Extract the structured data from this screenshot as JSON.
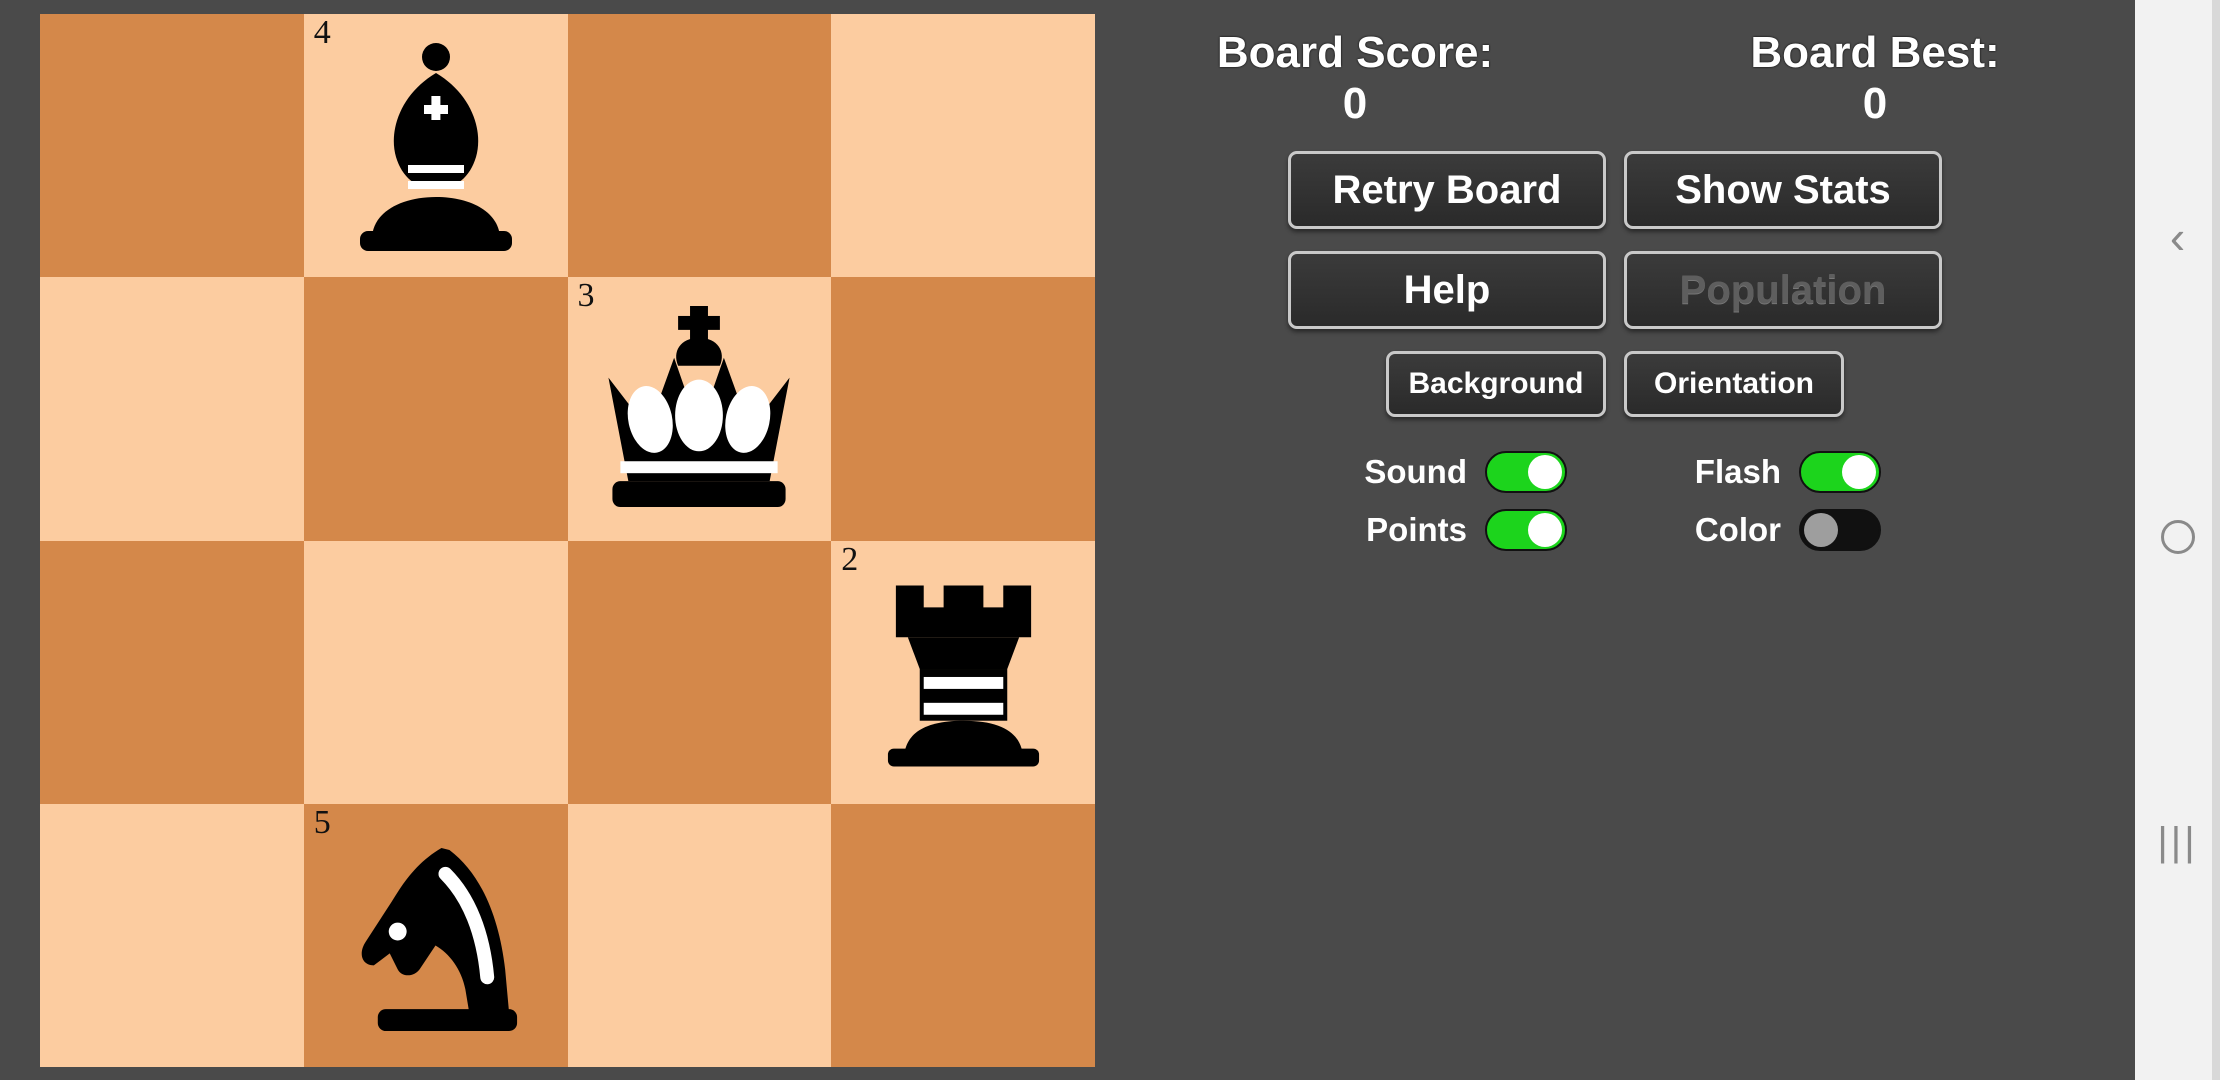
{
  "board": {
    "rows": 4,
    "cols": 4,
    "colors": {
      "light": "#fcccA0",
      "dark": "#d4884a"
    },
    "squares": [
      {
        "row": 0,
        "col": 0,
        "shade": "dark",
        "number": "",
        "piece": ""
      },
      {
        "row": 0,
        "col": 1,
        "shade": "light",
        "number": "4",
        "piece": "bishop"
      },
      {
        "row": 0,
        "col": 2,
        "shade": "dark",
        "number": "",
        "piece": ""
      },
      {
        "row": 0,
        "col": 3,
        "shade": "light",
        "number": "",
        "piece": ""
      },
      {
        "row": 1,
        "col": 0,
        "shade": "light",
        "number": "",
        "piece": ""
      },
      {
        "row": 1,
        "col": 1,
        "shade": "dark",
        "number": "",
        "piece": ""
      },
      {
        "row": 1,
        "col": 2,
        "shade": "light",
        "number": "3",
        "piece": "king"
      },
      {
        "row": 1,
        "col": 3,
        "shade": "dark",
        "number": "",
        "piece": ""
      },
      {
        "row": 2,
        "col": 0,
        "shade": "dark",
        "number": "",
        "piece": ""
      },
      {
        "row": 2,
        "col": 1,
        "shade": "light",
        "number": "",
        "piece": ""
      },
      {
        "row": 2,
        "col": 2,
        "shade": "dark",
        "number": "",
        "piece": ""
      },
      {
        "row": 2,
        "col": 3,
        "shade": "light",
        "number": "2",
        "piece": "rook"
      },
      {
        "row": 3,
        "col": 0,
        "shade": "light",
        "number": "",
        "piece": ""
      },
      {
        "row": 3,
        "col": 1,
        "shade": "dark",
        "number": "5",
        "piece": "knight"
      },
      {
        "row": 3,
        "col": 2,
        "shade": "light",
        "number": "",
        "piece": ""
      },
      {
        "row": 3,
        "col": 3,
        "shade": "dark",
        "number": "",
        "piece": ""
      }
    ]
  },
  "panel": {
    "scores": [
      {
        "label": "Board Score:",
        "value": "0"
      },
      {
        "label": "Board Best:",
        "value": "0"
      }
    ],
    "buttons": [
      {
        "id": "retry-board",
        "label": "Retry Board",
        "size": "big",
        "enabled": true
      },
      {
        "id": "show-stats",
        "label": "Show Stats",
        "size": "big",
        "enabled": true
      },
      {
        "id": "help",
        "label": "Help",
        "size": "big",
        "enabled": true
      },
      {
        "id": "population",
        "label": "Population",
        "size": "big",
        "enabled": false
      },
      {
        "id": "background",
        "label": "Background",
        "size": "small",
        "enabled": true
      },
      {
        "id": "orientation",
        "label": "Orientation",
        "size": "small",
        "enabled": true
      }
    ],
    "toggles": [
      {
        "id": "sound",
        "label": "Sound",
        "state": "on"
      },
      {
        "id": "flash",
        "label": "Flash",
        "state": "on"
      },
      {
        "id": "points",
        "label": "Points",
        "state": "on"
      },
      {
        "id": "color",
        "label": "Color",
        "state": "off"
      }
    ],
    "accent_on_color": "#1cd41c",
    "accent_off_color": "#9e9e9e"
  },
  "navbar": {
    "back_icon": "back-chevron-icon",
    "home_icon": "home-circle-icon",
    "recent_icon": "recent-apps-icon",
    "recent_glyph": "|||",
    "back_glyph": "‹"
  }
}
